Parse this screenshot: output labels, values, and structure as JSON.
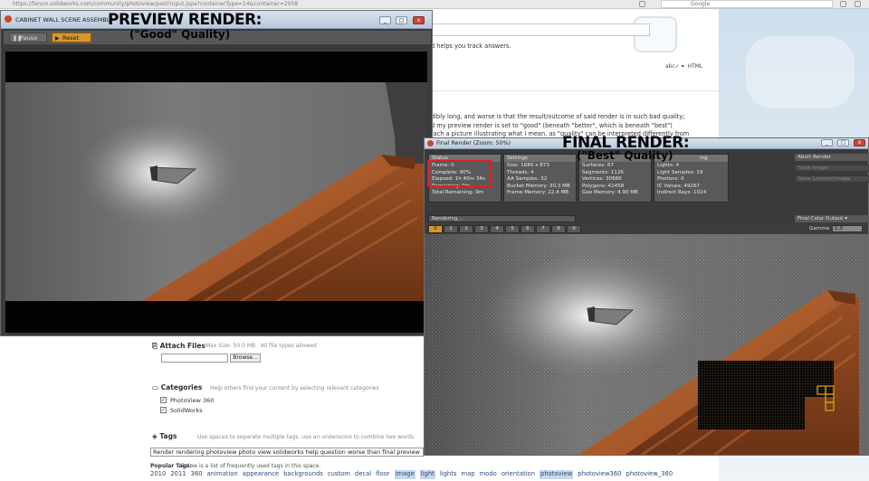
{
  "browser": {
    "url": "https://forum.solidworks.com/community/photoview/post!input.jspa?containerType=14&container=2058",
    "search_placeholder": "Google"
  },
  "page": {
    "track_text": "d helps you track answers.",
    "html_label": "HTML",
    "para1": "dibly long, and worse is that the result/outcome of said render is in such bad quality;",
    "para2": "d my preview render is set to \"good\" (beneath \"better\", which is beneath \"best\")",
    "para3": "tach a picture illustrating what I mean, as \"quality\" can be interpreted differently from",
    "attach_label": "Attach Files",
    "attach_hint": "Max Size: 50.0 MB . All file types allowed",
    "browse_label": "Browse...",
    "categories_label": "Categories",
    "categories_hint": "Help others find your content by selecting relevant categories",
    "category_items": [
      {
        "label": "PhotoView 360",
        "checked": "✓"
      },
      {
        "label": "SolidWorks",
        "checked": "✓"
      }
    ],
    "tags_label": "Tags",
    "tags_hint": "Use spaces to separate multiple tags. use an underscore to combine two words",
    "tags_value": "Render rendering photoview photo view solidworks help question worse than final preview",
    "popular_tags_label": "Popular Tags:",
    "popular_tags_desc": "Below is a list of frequently used tags in this space.",
    "popular_tags": [
      "2010",
      "2011",
      "360",
      "animation",
      "appearance",
      "backgrounds",
      "custom",
      "decal",
      "floor",
      "image",
      "light",
      "lights",
      "map",
      "modo",
      "orientation",
      "photoview",
      "photoview360",
      "photoview_360"
    ]
  },
  "preview_window": {
    "title": "CABINET WALL SCENE ASSEMBLY",
    "pause_label": "Pause",
    "reset_label": "Reset",
    "min": "_",
    "max": "□",
    "close": "x"
  },
  "final_window": {
    "title": "Final Render (Zoom: 50%)",
    "min": "_",
    "max": "□",
    "close": "x",
    "status": {
      "header": "Status",
      "lines": [
        "Frame: 0",
        "Complete: 90%",
        "Elapsed: 1h 40m 34s",
        "Remaining: 9m",
        "Total Remaining: 9m"
      ]
    },
    "settings": {
      "header": "Settings",
      "lines": [
        "Size: 1680 x 873",
        "Threads: 4",
        "AA Samples: 32",
        "Bucket Memory: 30.3 MB",
        "Frame Memory: 22.4 MB"
      ]
    },
    "geometry": {
      "header": "",
      "lines": [
        "Surfaces: 67",
        "Segments: 1126",
        "Vertices: 30686",
        "Polygons: 41458",
        "Geo Memory: 4.90 MB"
      ]
    },
    "lighting": {
      "header": "ing",
      "lines": [
        "Lights: 4",
        "Light Samples: 19",
        "Photons: 0",
        "IC Values: 49267",
        "Indirect Rays: 1024"
      ]
    },
    "rendering_label": "Rendering...",
    "frames": [
      "0",
      "1",
      "2",
      "3",
      "4",
      "5",
      "6",
      "7",
      "8",
      "9"
    ],
    "abort_label": "Abort Render",
    "save_image": "Save Image",
    "save_layered": "Save Layered Image",
    "output_label": "Final Color Output",
    "gamma_label": "Gamma",
    "gamma_value": "1.3"
  },
  "captions": {
    "preview_title": "PREVIEW RENDER:",
    "preview_sub": "(\"Good\" Quality)",
    "final_title": "FINAL RENDER:",
    "final_sub": "(\"Best\" Quality)"
  },
  "colors": {
    "accent_orange": "#d8962b",
    "highlight_red": "#e01f25",
    "wood": "#a5582a"
  }
}
